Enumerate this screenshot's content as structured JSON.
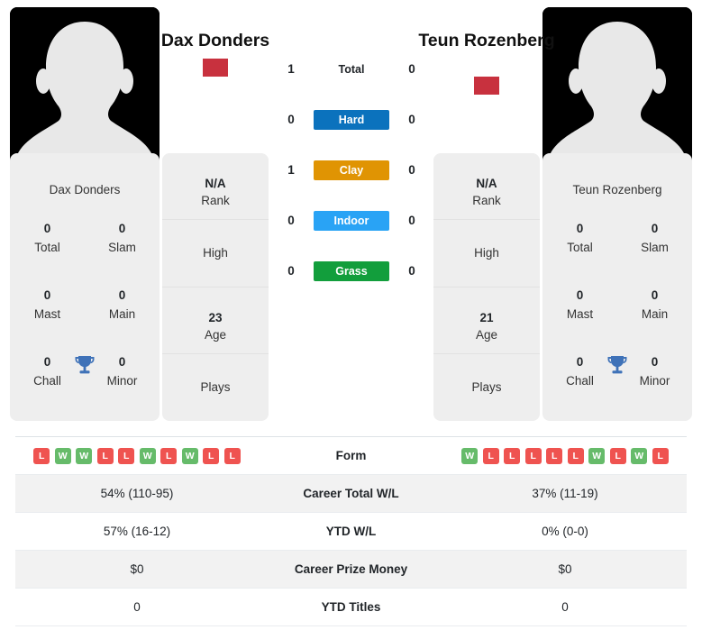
{
  "players": {
    "left": {
      "name": "Dax Donders",
      "card_name": "Dax Donders",
      "flag": "netherlands-flag",
      "titles": [
        {
          "value": "0",
          "label": "Total"
        },
        {
          "value": "0",
          "label": "Slam"
        },
        {
          "value": "0",
          "label": "Mast"
        },
        {
          "value": "0",
          "label": "Main"
        },
        {
          "value": "0",
          "label": "Chall"
        },
        {
          "value": "0",
          "label": "Minor"
        }
      ],
      "info": [
        {
          "value": "N/A",
          "label": "Rank"
        },
        {
          "value": "",
          "label": "High"
        },
        {
          "value": "23",
          "label": "Age"
        },
        {
          "value": "",
          "label": "Plays"
        }
      ],
      "form": [
        "L",
        "W",
        "W",
        "L",
        "L",
        "W",
        "L",
        "W",
        "L",
        "L"
      ],
      "career_total_wl": "54% (110-95)",
      "ytd_wl": "57% (16-12)",
      "career_prize_money": "$0",
      "ytd_titles": "0"
    },
    "right": {
      "name": "Teun Rozenberg",
      "card_name": "Teun Rozenberg",
      "flag": "netherlands-flag",
      "titles": [
        {
          "value": "0",
          "label": "Total"
        },
        {
          "value": "0",
          "label": "Slam"
        },
        {
          "value": "0",
          "label": "Mast"
        },
        {
          "value": "0",
          "label": "Main"
        },
        {
          "value": "0",
          "label": "Chall"
        },
        {
          "value": "0",
          "label": "Minor"
        }
      ],
      "info": [
        {
          "value": "N/A",
          "label": "Rank"
        },
        {
          "value": "",
          "label": "High"
        },
        {
          "value": "21",
          "label": "Age"
        },
        {
          "value": "",
          "label": "Plays"
        }
      ],
      "form": [
        "W",
        "L",
        "L",
        "L",
        "L",
        "L",
        "W",
        "L",
        "W",
        "L"
      ],
      "career_total_wl": "37% (11-19)",
      "ytd_wl": "0% (0-0)",
      "career_prize_money": "$0",
      "ytd_titles": "0"
    }
  },
  "head_to_head": [
    {
      "label": "Total",
      "left": "1",
      "right": "0",
      "color": "",
      "plain": true
    },
    {
      "label": "Hard",
      "left": "0",
      "right": "0",
      "color": "#0b72bd",
      "plain": false
    },
    {
      "label": "Clay",
      "left": "1",
      "right": "0",
      "color": "#e09403",
      "plain": false
    },
    {
      "label": "Indoor",
      "left": "0",
      "right": "0",
      "color": "#29a3f5",
      "plain": false
    },
    {
      "label": "Grass",
      "left": "0",
      "right": "0",
      "color": "#129e3c",
      "plain": false
    }
  ],
  "table": {
    "rows": [
      {
        "label": "Form",
        "type": "form"
      },
      {
        "label": "Career Total W/L",
        "type": "text",
        "key": "career_total_wl"
      },
      {
        "label": "YTD W/L",
        "type": "text",
        "key": "ytd_wl"
      },
      {
        "label": "Career Prize Money",
        "type": "text",
        "key": "career_prize_money"
      },
      {
        "label": "YTD Titles",
        "type": "text",
        "key": "ytd_titles"
      }
    ]
  },
  "colors": {
    "hard": "#0b72bd",
    "clay": "#e09403",
    "indoor": "#29a3f5",
    "grass": "#129e3c",
    "win": "#66bb6a",
    "loss": "#ef5350",
    "card_bg": "#eeeeee",
    "flag_red": "#c8313e",
    "flag_blue": "#32599f",
    "trophy": "#3f72b8"
  }
}
